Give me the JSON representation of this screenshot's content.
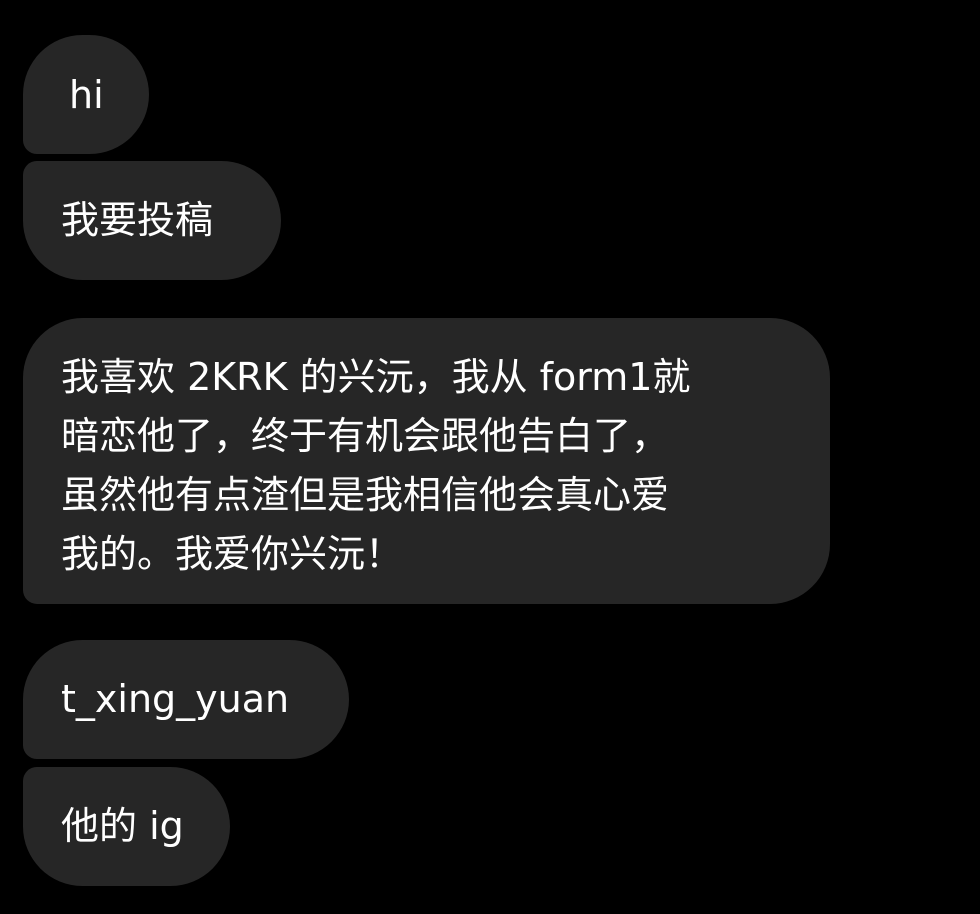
{
  "messages": [
    {
      "text": "hi"
    },
    {
      "text": "我要投稿"
    },
    {
      "text": "我喜欢 2KRK 的兴沅，我从 form1就\n暗恋他了，终于有机会跟他告白了，\n虽然他有点渣但是我相信他会真心爱\n我的。我爱你兴沅！"
    },
    {
      "text": "t_xing_yuan"
    },
    {
      "text": "他的 ig"
    }
  ],
  "colors": {
    "background": "#000000",
    "bubble": "#262626",
    "text": "#ffffff"
  }
}
